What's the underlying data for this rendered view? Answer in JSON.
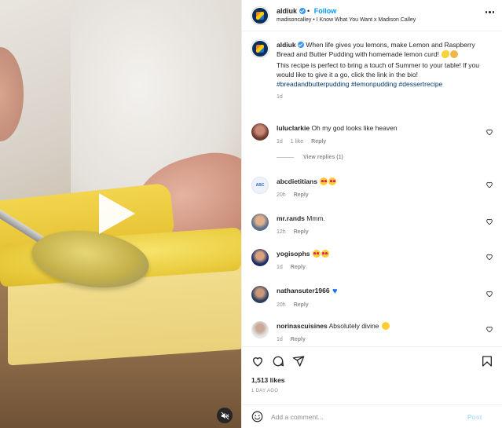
{
  "header": {
    "username": "aldiuk",
    "separator": "•",
    "follow_label": "Follow",
    "subtitle": "madisoncalley • I Know What You Want x Madison Calley"
  },
  "caption": {
    "username": "aldiuk",
    "text1": "When life gives you lemons, make Lemon and Raspberry Bread and Butter Pudding with homemade lemon curd!",
    "text2": "This recipe is perfect to bring a touch of Summer to your table! If you would like to give it a go, click the link in the bio!",
    "hashtags": [
      "#breadandbutterpudding",
      "#lemonpudding",
      "#dessertrecipe"
    ],
    "time": "1d"
  },
  "comments": [
    {
      "username": "luluclarkie",
      "text": "Oh my god looks like heaven",
      "time": "1d",
      "likes": "1 like",
      "reply": "Reply",
      "avatar_color": "#8a4a3c"
    },
    {
      "username": "abcdietitians",
      "text": "",
      "time": "20h",
      "likes": "",
      "reply": "Reply",
      "avatar_color": "#e8f0fb",
      "avatar_text": "ABC"
    },
    {
      "username": "mr.rands",
      "text": "Mmm.",
      "time": "12h",
      "likes": "",
      "reply": "Reply",
      "avatar_color": "#7a5a3e"
    },
    {
      "username": "yogisophs",
      "text": "",
      "time": "1d",
      "likes": "",
      "reply": "Reply",
      "avatar_color": "#2a3d7a"
    },
    {
      "username": "nathansuter1966",
      "text": "",
      "time": "20h",
      "likes": "",
      "reply": "Reply",
      "avatar_color": "#3a4e6e"
    },
    {
      "username": "norinascuisines",
      "text": "Absolutely divine",
      "time": "1d",
      "likes": "",
      "reply": "Reply",
      "avatar_color": "#d9d9d9"
    }
  ],
  "view_replies": "View replies (1)",
  "likes": "1,513 likes",
  "date": "1 DAY AGO",
  "add_comment": {
    "placeholder": "Add a comment...",
    "post_label": "Post"
  },
  "colors": {
    "link_blue": "#0095f6",
    "hashtag": "#00376b",
    "muted": "#8e8e8e"
  },
  "icons": [
    "play-icon",
    "mute-icon",
    "more-icon",
    "verified-icon",
    "heart-icon",
    "comment-icon",
    "share-icon",
    "save-icon",
    "emoji-icon"
  ]
}
